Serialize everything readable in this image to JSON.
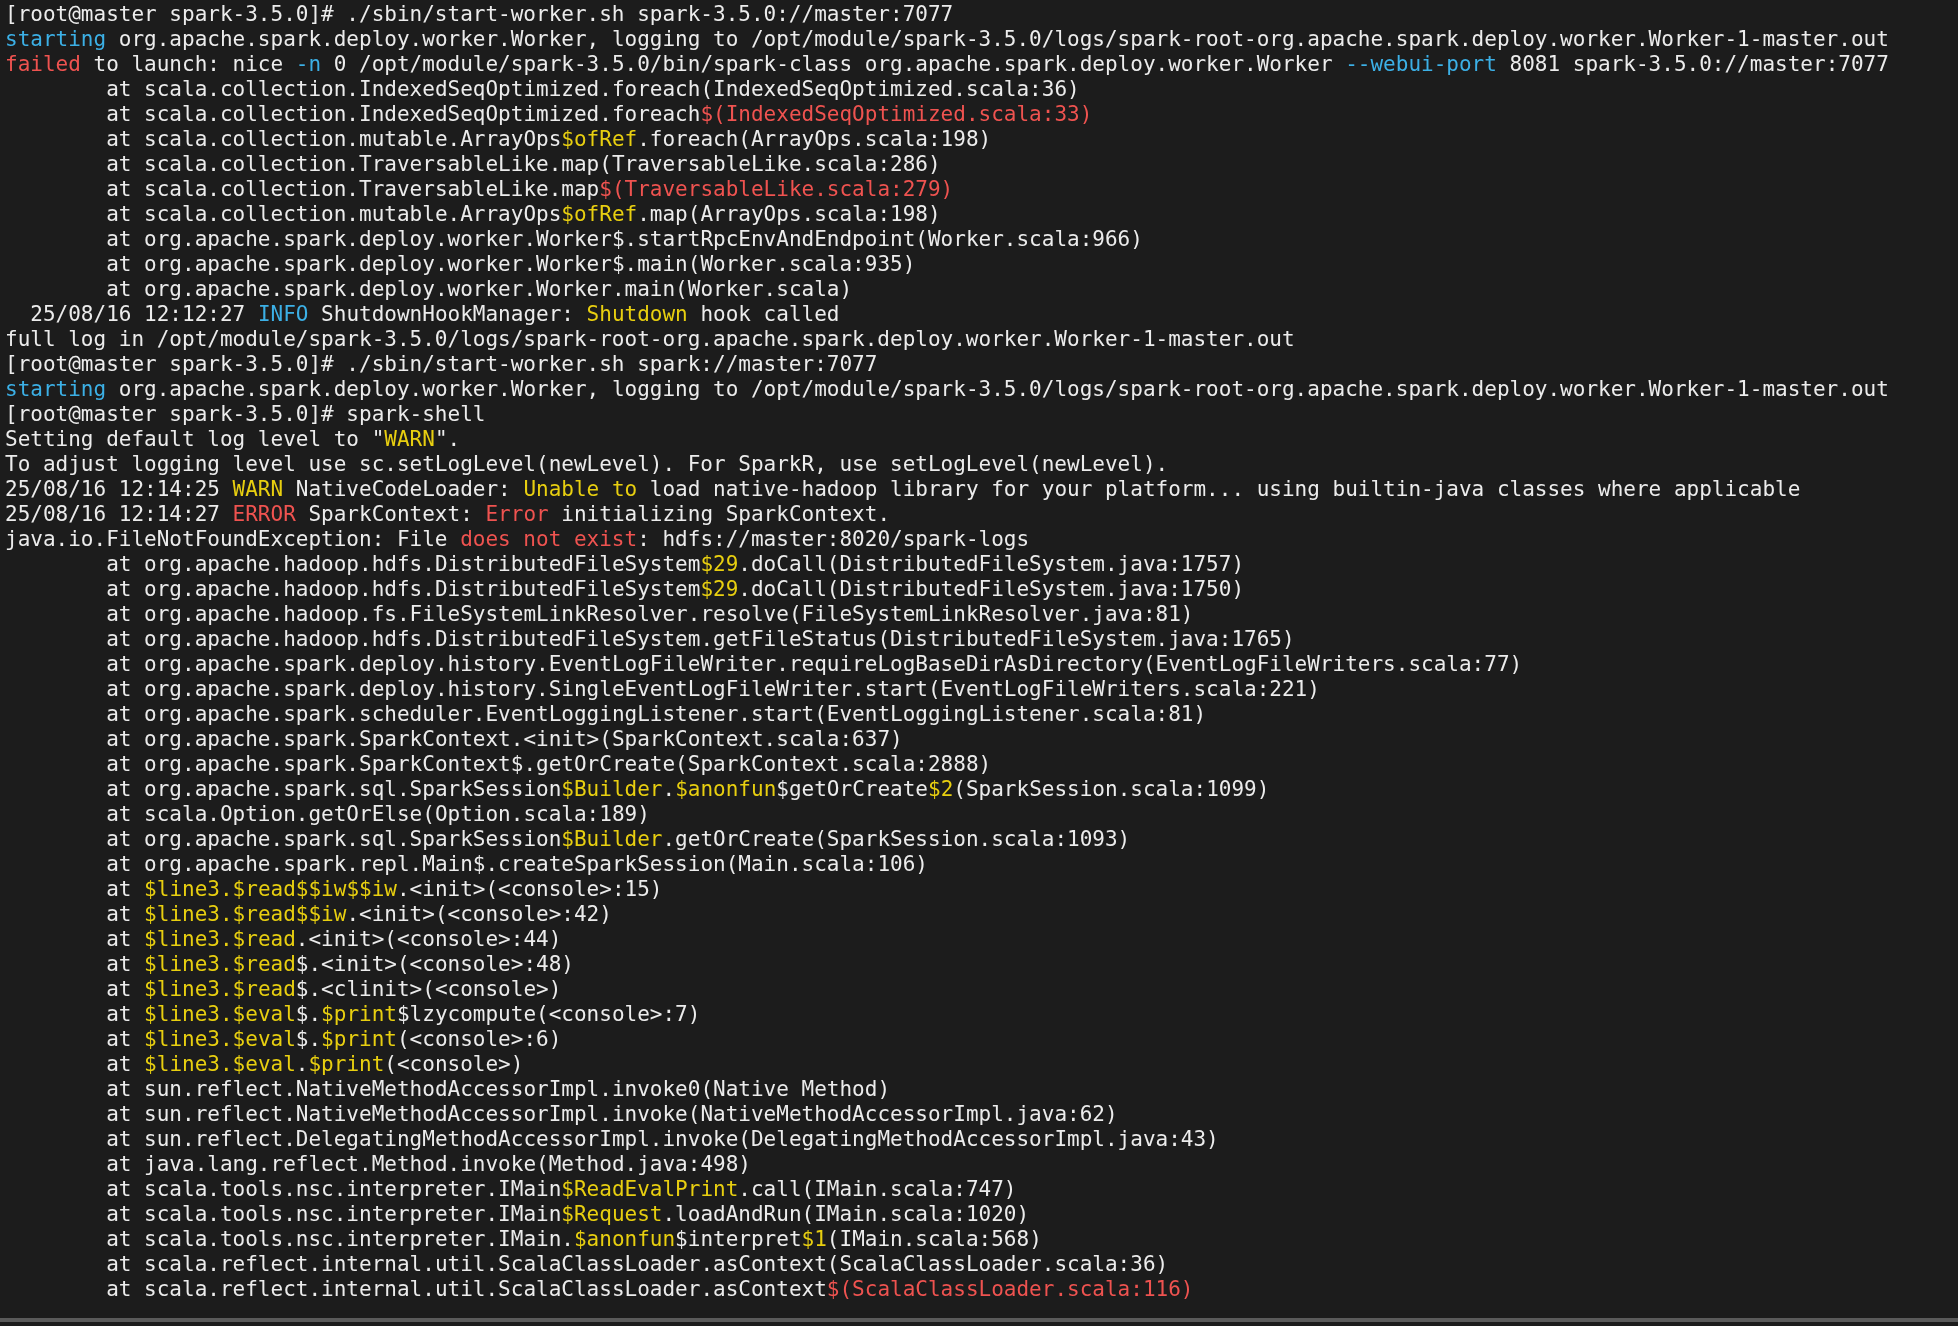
{
  "terminal": {
    "lines": [
      {
        "segments": [
          {
            "kind": "text",
            "text": "[root@master spark-3.5.0]# ./sbin/start-worker.sh spark-3.5.0://master:7077"
          }
        ]
      },
      {
        "segments": [
          {
            "kind": "info",
            "text": "starting"
          },
          {
            "kind": "text",
            "text": " org.apache.spark.deploy.worker.Worker, logging to /opt/module/spark-3.5.0/logs/spark-root-org.apache.spark.deploy.worker.Worker-1-master.out"
          }
        ]
      },
      {
        "segments": [
          {
            "kind": "error",
            "text": "failed"
          },
          {
            "kind": "text",
            "text": " to launch: nice "
          },
          {
            "kind": "info",
            "text": "-n"
          },
          {
            "kind": "text",
            "text": " 0 /opt/module/spark-3.5.0/bin/spark-class org.apache.spark.deploy.worker.Worker "
          },
          {
            "kind": "info",
            "text": "--webui-port"
          },
          {
            "kind": "text",
            "text": " 8081 spark-3.5.0://master:7077"
          }
        ]
      },
      {
        "segments": [
          {
            "kind": "text",
            "text": "\tat scala.collection.IndexedSeqOptimized.foreach(IndexedSeqOptimized.scala:36)"
          }
        ]
      },
      {
        "segments": [
          {
            "kind": "text",
            "text": "\tat scala.collection.IndexedSeqOptimized.foreach"
          },
          {
            "kind": "error",
            "text": "$(IndexedSeqOptimized.scala:33)"
          }
        ]
      },
      {
        "segments": [
          {
            "kind": "text",
            "text": "\tat scala.collection.mutable.ArrayOps"
          },
          {
            "kind": "warn",
            "text": "$ofRef"
          },
          {
            "kind": "text",
            "text": ".foreach(ArrayOps.scala:198)"
          }
        ]
      },
      {
        "segments": [
          {
            "kind": "text",
            "text": "\tat scala.collection.TraversableLike.map(TraversableLike.scala:286)"
          }
        ]
      },
      {
        "segments": [
          {
            "kind": "text",
            "text": "\tat scala.collection.TraversableLike.map"
          },
          {
            "kind": "error",
            "text": "$(TraversableLike.scala:279)"
          }
        ]
      },
      {
        "segments": [
          {
            "kind": "text",
            "text": "\tat scala.collection.mutable.ArrayOps"
          },
          {
            "kind": "warn",
            "text": "$ofRef"
          },
          {
            "kind": "text",
            "text": ".map(ArrayOps.scala:198)"
          }
        ]
      },
      {
        "segments": [
          {
            "kind": "text",
            "text": "\tat org.apache.spark.deploy.worker.Worker$.startRpcEnvAndEndpoint(Worker.scala:966)"
          }
        ]
      },
      {
        "segments": [
          {
            "kind": "text",
            "text": "\tat org.apache.spark.deploy.worker.Worker$.main(Worker.scala:935)"
          }
        ]
      },
      {
        "segments": [
          {
            "kind": "text",
            "text": "\tat org.apache.spark.deploy.worker.Worker.main(Worker.scala)"
          }
        ]
      },
      {
        "segments": [
          {
            "kind": "text",
            "text": "  25/08/16 12:12:27 "
          },
          {
            "kind": "info",
            "text": "INFO"
          },
          {
            "kind": "text",
            "text": " ShutdownHookManager: "
          },
          {
            "kind": "warn",
            "text": "Shutdown"
          },
          {
            "kind": "text",
            "text": " hook called"
          }
        ]
      },
      {
        "segments": [
          {
            "kind": "text",
            "text": "full log in /opt/module/spark-3.5.0/logs/spark-root-org.apache.spark.deploy.worker.Worker-1-master.out"
          }
        ]
      },
      {
        "segments": [
          {
            "kind": "text",
            "text": "[root@master spark-3.5.0]# ./sbin/start-worker.sh spark://master:7077"
          }
        ]
      },
      {
        "segments": [
          {
            "kind": "info",
            "text": "starting"
          },
          {
            "kind": "text",
            "text": " org.apache.spark.deploy.worker.Worker, logging to /opt/module/spark-3.5.0/logs/spark-root-org.apache.spark.deploy.worker.Worker-1-master.out"
          }
        ]
      },
      {
        "segments": [
          {
            "kind": "text",
            "text": "[root@master spark-3.5.0]# spark-shell"
          }
        ]
      },
      {
        "segments": [
          {
            "kind": "text",
            "text": "Setting default log level to \""
          },
          {
            "kind": "warn",
            "text": "WARN"
          },
          {
            "kind": "text",
            "text": "\"."
          }
        ]
      },
      {
        "segments": [
          {
            "kind": "text",
            "text": "To adjust logging level use sc.setLogLevel(newLevel). For SparkR, use setLogLevel(newLevel)."
          }
        ]
      },
      {
        "segments": [
          {
            "kind": "text",
            "text": "25/08/16 12:14:25 "
          },
          {
            "kind": "warn",
            "text": "WARN"
          },
          {
            "kind": "text",
            "text": " NativeCodeLoader: "
          },
          {
            "kind": "warn",
            "text": "Unable to"
          },
          {
            "kind": "text",
            "text": " load native-hadoop library for your platform... using builtin-java classes where applicable"
          }
        ]
      },
      {
        "segments": [
          {
            "kind": "text",
            "text": "25/08/16 12:14:27 "
          },
          {
            "kind": "error",
            "text": "ERROR"
          },
          {
            "kind": "text",
            "text": " SparkContext: "
          },
          {
            "kind": "error",
            "text": "Error"
          },
          {
            "kind": "text",
            "text": " initializing SparkContext."
          }
        ]
      },
      {
        "segments": [
          {
            "kind": "text",
            "text": "java.io.FileNotFoundException: File "
          },
          {
            "kind": "error",
            "text": "does not exist"
          },
          {
            "kind": "text",
            "text": ": hdfs://master:8020/spark-logs"
          }
        ]
      },
      {
        "segments": [
          {
            "kind": "text",
            "text": "\tat org.apache.hadoop.hdfs.DistributedFileSystem"
          },
          {
            "kind": "warn",
            "text": "$29"
          },
          {
            "kind": "text",
            "text": ".doCall(DistributedFileSystem.java:1757)"
          }
        ]
      },
      {
        "segments": [
          {
            "kind": "text",
            "text": "\tat org.apache.hadoop.hdfs.DistributedFileSystem"
          },
          {
            "kind": "warn",
            "text": "$29"
          },
          {
            "kind": "text",
            "text": ".doCall(DistributedFileSystem.java:1750)"
          }
        ]
      },
      {
        "segments": [
          {
            "kind": "text",
            "text": "\tat org.apache.hadoop.fs.FileSystemLinkResolver.resolve(FileSystemLinkResolver.java:81)"
          }
        ]
      },
      {
        "segments": [
          {
            "kind": "text",
            "text": "\tat org.apache.hadoop.hdfs.DistributedFileSystem.getFileStatus(DistributedFileSystem.java:1765)"
          }
        ]
      },
      {
        "segments": [
          {
            "kind": "text",
            "text": "\tat org.apache.spark.deploy.history.EventLogFileWriter.requireLogBaseDirAsDirectory(EventLogFileWriters.scala:77)"
          }
        ]
      },
      {
        "segments": [
          {
            "kind": "text",
            "text": "\tat org.apache.spark.deploy.history.SingleEventLogFileWriter.start(EventLogFileWriters.scala:221)"
          }
        ]
      },
      {
        "segments": [
          {
            "kind": "text",
            "text": "\tat org.apache.spark.scheduler.EventLoggingListener.start(EventLoggingListener.scala:81)"
          }
        ]
      },
      {
        "segments": [
          {
            "kind": "text",
            "text": "\tat org.apache.spark.SparkContext.<init>(SparkContext.scala:637)"
          }
        ]
      },
      {
        "segments": [
          {
            "kind": "text",
            "text": "\tat org.apache.spark.SparkContext$.getOrCreate(SparkContext.scala:2888)"
          }
        ]
      },
      {
        "segments": [
          {
            "kind": "text",
            "text": "\tat org.apache.spark.sql.SparkSession"
          },
          {
            "kind": "warn",
            "text": "$Builder"
          },
          {
            "kind": "text",
            "text": "."
          },
          {
            "kind": "warn",
            "text": "$anonfun"
          },
          {
            "kind": "text",
            "text": "$getOrCreate"
          },
          {
            "kind": "warn",
            "text": "$2"
          },
          {
            "kind": "text",
            "text": "(SparkSession.scala:1099)"
          }
        ]
      },
      {
        "segments": [
          {
            "kind": "text",
            "text": "\tat scala.Option.getOrElse(Option.scala:189)"
          }
        ]
      },
      {
        "segments": [
          {
            "kind": "text",
            "text": "\tat org.apache.spark.sql.SparkSession"
          },
          {
            "kind": "warn",
            "text": "$Builder"
          },
          {
            "kind": "text",
            "text": ".getOrCreate(SparkSession.scala:1093)"
          }
        ]
      },
      {
        "segments": [
          {
            "kind": "text",
            "text": "\tat org.apache.spark.repl.Main$.createSparkSession(Main.scala:106)"
          }
        ]
      },
      {
        "segments": [
          {
            "kind": "text",
            "text": "\tat "
          },
          {
            "kind": "warn",
            "text": "$line3.$read$$iw$$iw"
          },
          {
            "kind": "text",
            "text": ".<init>(<console>:15)"
          }
        ]
      },
      {
        "segments": [
          {
            "kind": "text",
            "text": "\tat "
          },
          {
            "kind": "warn",
            "text": "$line3.$read$$iw"
          },
          {
            "kind": "text",
            "text": ".<init>(<console>:42)"
          }
        ]
      },
      {
        "segments": [
          {
            "kind": "text",
            "text": "\tat "
          },
          {
            "kind": "warn",
            "text": "$line3.$read"
          },
          {
            "kind": "text",
            "text": ".<init>(<console>:44)"
          }
        ]
      },
      {
        "segments": [
          {
            "kind": "text",
            "text": "\tat "
          },
          {
            "kind": "warn",
            "text": "$line3.$read"
          },
          {
            "kind": "text",
            "text": "$.<init>(<console>:48)"
          }
        ]
      },
      {
        "segments": [
          {
            "kind": "text",
            "text": "\tat "
          },
          {
            "kind": "warn",
            "text": "$line3.$read"
          },
          {
            "kind": "text",
            "text": "$.<clinit>(<console>)"
          }
        ]
      },
      {
        "segments": [
          {
            "kind": "text",
            "text": "\tat "
          },
          {
            "kind": "warn",
            "text": "$line3.$eval"
          },
          {
            "kind": "text",
            "text": "$."
          },
          {
            "kind": "warn",
            "text": "$print"
          },
          {
            "kind": "text",
            "text": "$lzycompute(<console>:7)"
          }
        ]
      },
      {
        "segments": [
          {
            "kind": "text",
            "text": "\tat "
          },
          {
            "kind": "warn",
            "text": "$line3.$eval"
          },
          {
            "kind": "text",
            "text": "$."
          },
          {
            "kind": "warn",
            "text": "$print"
          },
          {
            "kind": "text",
            "text": "(<console>:6)"
          }
        ]
      },
      {
        "segments": [
          {
            "kind": "text",
            "text": "\tat "
          },
          {
            "kind": "warn",
            "text": "$line3.$eval"
          },
          {
            "kind": "text",
            "text": "."
          },
          {
            "kind": "warn",
            "text": "$print"
          },
          {
            "kind": "text",
            "text": "(<console>)"
          }
        ]
      },
      {
        "segments": [
          {
            "kind": "text",
            "text": "\tat sun.reflect.NativeMethodAccessorImpl.invoke0(Native Method)"
          }
        ]
      },
      {
        "segments": [
          {
            "kind": "text",
            "text": "\tat sun.reflect.NativeMethodAccessorImpl.invoke(NativeMethodAccessorImpl.java:62)"
          }
        ]
      },
      {
        "segments": [
          {
            "kind": "text",
            "text": "\tat sun.reflect.DelegatingMethodAccessorImpl.invoke(DelegatingMethodAccessorImpl.java:43)"
          }
        ]
      },
      {
        "segments": [
          {
            "kind": "text",
            "text": "\tat java.lang.reflect.Method.invoke(Method.java:498)"
          }
        ]
      },
      {
        "segments": [
          {
            "kind": "text",
            "text": "\tat scala.tools.nsc.interpreter.IMain"
          },
          {
            "kind": "warn",
            "text": "$ReadEvalPrint"
          },
          {
            "kind": "text",
            "text": ".call(IMain.scala:747)"
          }
        ]
      },
      {
        "segments": [
          {
            "kind": "text",
            "text": "\tat scala.tools.nsc.interpreter.IMain"
          },
          {
            "kind": "warn",
            "text": "$Request"
          },
          {
            "kind": "text",
            "text": ".loadAndRun(IMain.scala:1020)"
          }
        ]
      },
      {
        "segments": [
          {
            "kind": "text",
            "text": "\tat scala.tools.nsc.interpreter.IMain."
          },
          {
            "kind": "warn",
            "text": "$anonfun"
          },
          {
            "kind": "text",
            "text": "$interpret"
          },
          {
            "kind": "warn",
            "text": "$1"
          },
          {
            "kind": "text",
            "text": "(IMain.scala:568)"
          }
        ]
      },
      {
        "segments": [
          {
            "kind": "text",
            "text": "\tat scala.reflect.internal.util.ScalaClassLoader.asContext(ScalaClassLoader.scala:36)"
          }
        ]
      },
      {
        "segments": [
          {
            "kind": "text",
            "text": "\tat scala.reflect.internal.util.ScalaClassLoader.asContext"
          },
          {
            "kind": "error",
            "text": "$(ScalaClassLoader.scala:116)"
          }
        ]
      }
    ]
  }
}
